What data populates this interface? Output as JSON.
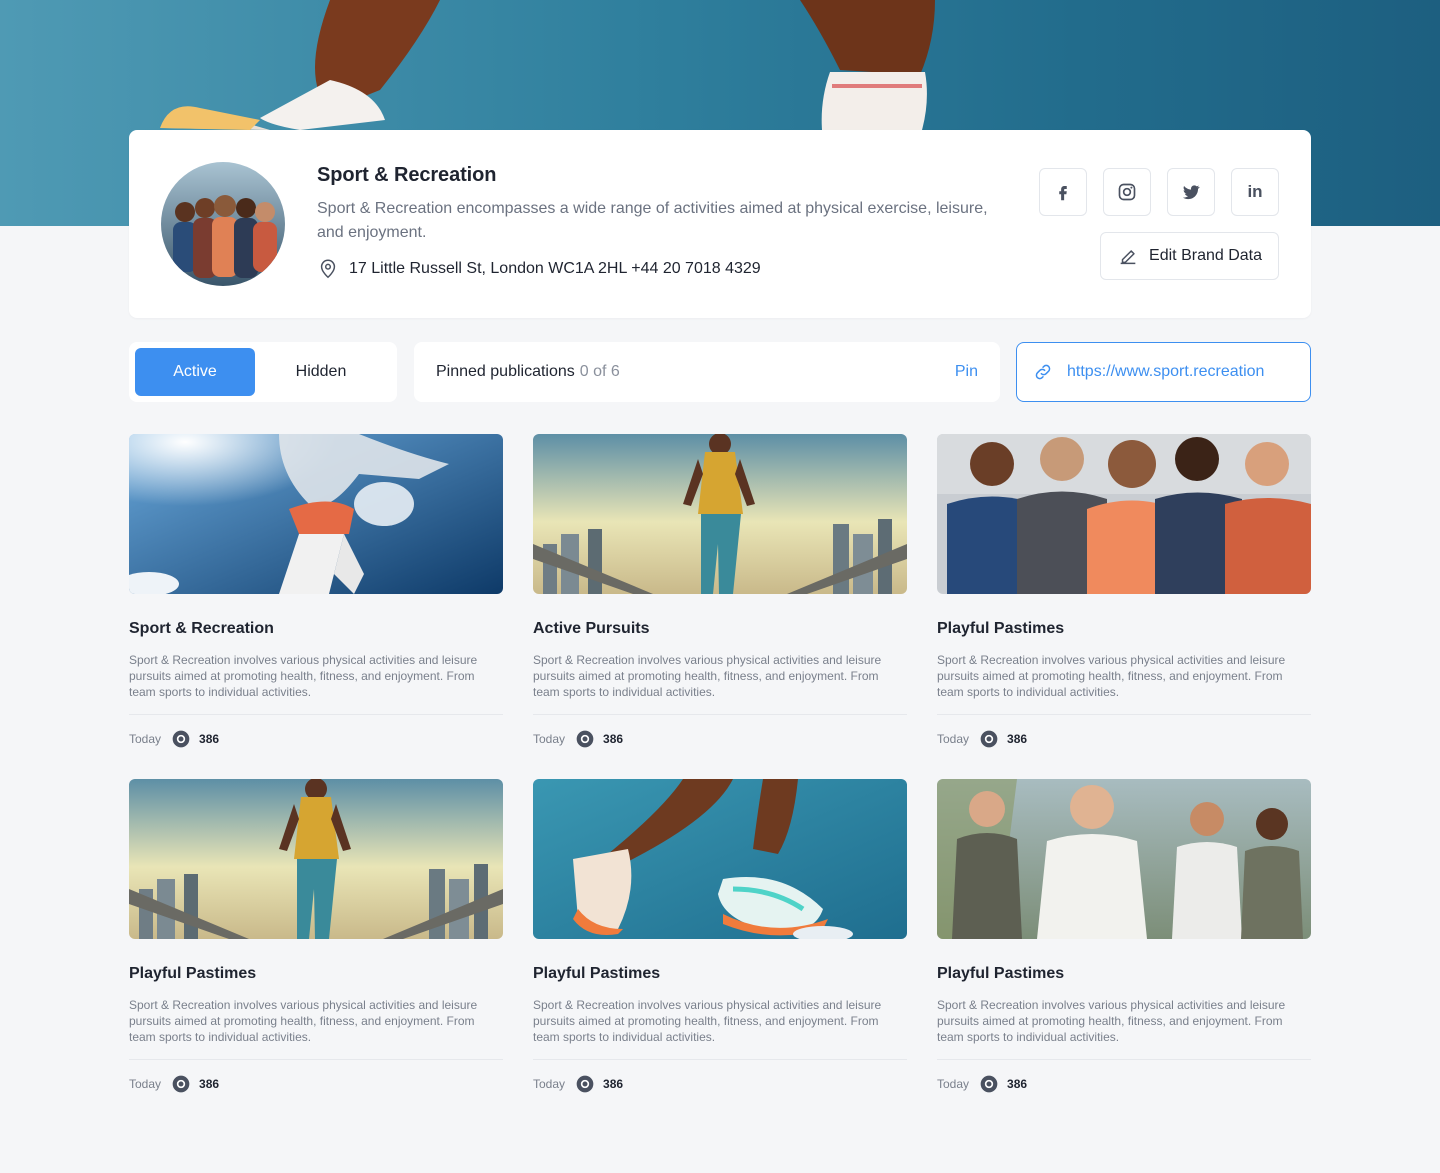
{
  "brand": {
    "name": "Sport & Recreation",
    "description": "Sport & Recreation encompasses a wide range of activities aimed at physical exercise, leisure, and enjoyment.",
    "address": "17 Little Russell St, London WC1A 2HL +44 20 7018 4329",
    "edit_label": "Edit Brand Data",
    "socials": [
      {
        "icon": "facebook-icon",
        "glyph": "f"
      },
      {
        "icon": "instagram-icon",
        "glyph": ""
      },
      {
        "icon": "twitter-icon",
        "glyph": ""
      },
      {
        "icon": "linkedin-icon",
        "glyph": "in"
      }
    ]
  },
  "tabs": [
    {
      "label": "Active",
      "active": true
    },
    {
      "label": "Hidden",
      "active": false
    }
  ],
  "pinned": {
    "label": "Pinned publications",
    "count": "0 of 6",
    "action": "Pin"
  },
  "url": "https://www.sport.recreation",
  "colors": {
    "accent": "#3d8ff0"
  },
  "publications": [
    {
      "title": "Sport & Recreation",
      "description": "Sport & Recreation involves various physical activities and leisure pursuits aimed at promoting health, fitness, and enjoyment. From team sports to individual activities.",
      "date": "Today",
      "views": "386",
      "image": "sky-jumper"
    },
    {
      "title": "Active Pursuits",
      "description": "Sport & Recreation involves various physical activities and leisure pursuits aimed at promoting health, fitness, and enjoyment. From team sports to individual activities.",
      "date": "Today",
      "views": "386",
      "image": "city-runner"
    },
    {
      "title": "Playful Pastimes",
      "description": "Sport & Recreation involves various physical activities and leisure pursuits aimed at promoting health, fitness, and enjoyment. From team sports to individual activities.",
      "date": "Today",
      "views": "386",
      "image": "athlete-group"
    },
    {
      "title": "Playful Pastimes",
      "description": "Sport & Recreation involves various physical activities and leisure pursuits aimed at promoting health, fitness, and enjoyment. From team sports to individual activities.",
      "date": "Today",
      "views": "386",
      "image": "city-runner"
    },
    {
      "title": "Playful Pastimes",
      "description": "Sport & Recreation involves various physical activities and leisure pursuits aimed at promoting health, fitness, and enjoyment. From team sports to individual activities.",
      "date": "Today",
      "views": "386",
      "image": "running-legs"
    },
    {
      "title": "Playful Pastimes",
      "description": "Sport & Recreation involves various physical activities and leisure pursuits aimed at promoting health, fitness, and enjoyment. From team sports to individual activities.",
      "date": "Today",
      "views": "386",
      "image": "group-joggers"
    }
  ]
}
